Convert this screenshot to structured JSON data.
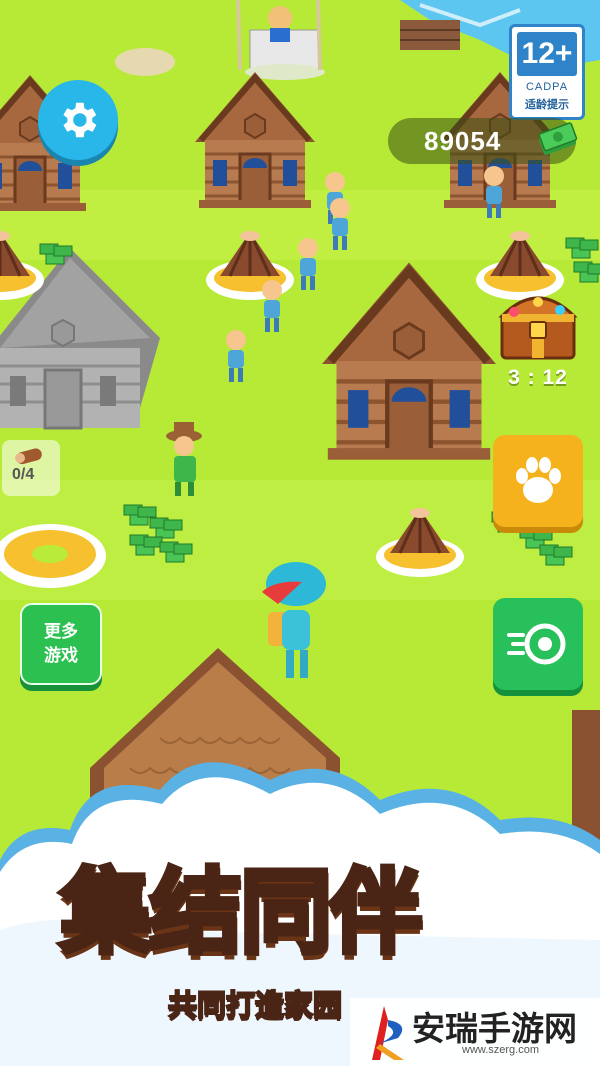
{
  "hud": {
    "money": "89054",
    "chest_timer": "3 : 12",
    "log_counter": "0/4"
  },
  "rating": {
    "age": "12+",
    "org": "CADPA",
    "hint": "适龄提示"
  },
  "buttons": {
    "more_games_line1": "更多",
    "more_games_line2": "游戏"
  },
  "banner": {
    "title_part1": "集结",
    "title_part2": "同伴",
    "subtitle": "共同打造家园"
  },
  "watermark": {
    "name": "安瑞手游网",
    "url": "www.szerg.com"
  },
  "icons": [
    "gear-icon",
    "cash-icon",
    "chest-icon",
    "log-icon",
    "paw-icon",
    "speed-icon"
  ],
  "colors": {
    "grass": "#b9ec3a",
    "settings": "#29b6e8",
    "paw_button": "#f5b21c",
    "speed_button": "#27c05a",
    "title_yellow": "#ffd21e"
  }
}
